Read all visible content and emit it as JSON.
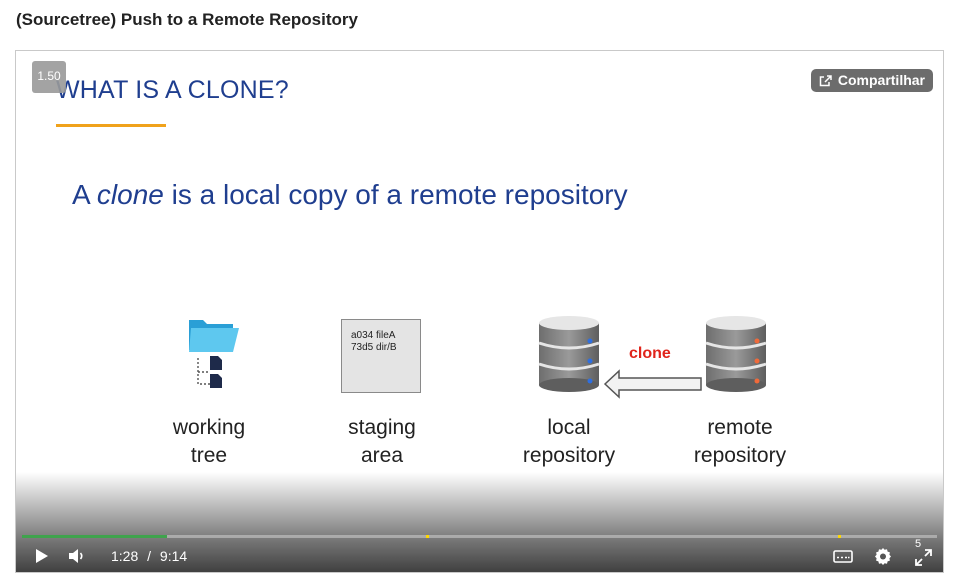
{
  "page": {
    "title": "(Sourcetree) Push to a Remote Repository"
  },
  "player": {
    "speed_badge": "1.50",
    "share_label": "Compartilhar",
    "current_time": "1:28",
    "separator": "/",
    "duration": "9:14",
    "progress_fraction": 0.159,
    "quality_badge": "5",
    "accent_color": "#3fa34d",
    "marker_color": "#ffd800"
  },
  "slide": {
    "heading": "WHAT IS A CLONE?",
    "definition_pre": "A ",
    "definition_italic": "clone",
    "definition_post": " is a local copy of a remote repository",
    "staging_lines": [
      "a034  fileA",
      "73d5  dir/B"
    ],
    "clone_label": "clone",
    "labels": {
      "working_tree": [
        "working",
        "tree"
      ],
      "staging_area": [
        "staging",
        "area"
      ],
      "local_repository": [
        "local",
        "repository"
      ],
      "remote_repository": [
        "remote",
        "repository"
      ]
    },
    "heading_color": "#1f3e8f",
    "underline_color": "#f0a21b",
    "clone_color": "#e0241b"
  },
  "icons": {
    "play": "play-icon",
    "volume": "volume-icon",
    "captions": "captions-icon",
    "settings": "gear-icon",
    "fullscreen": "fullscreen-icon",
    "share": "share-icon",
    "folder": "folder-icon",
    "tree": "tree-icon",
    "database": "database-icon",
    "arrow": "arrow-left-icon"
  }
}
